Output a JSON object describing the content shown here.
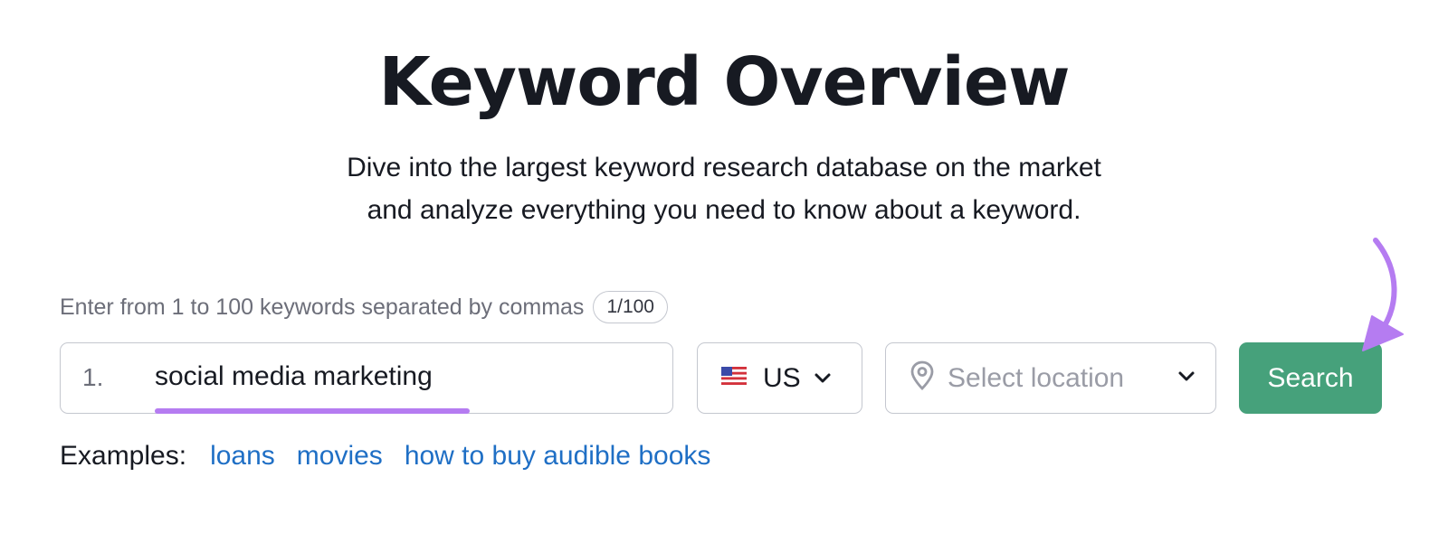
{
  "header": {
    "title": "Keyword Overview",
    "subtitle_line1": "Dive into the largest keyword research database on the market",
    "subtitle_line2": "and analyze everything you need to know about a keyword."
  },
  "form": {
    "hint": "Enter from 1 to 100 keywords separated by commas",
    "counter": "1/100",
    "keyword_number": "1.",
    "keyword_value": "social media marketing",
    "database": "US",
    "location_placeholder": "Select location",
    "search_label": "Search"
  },
  "examples": {
    "label": "Examples:",
    "links": [
      "loans",
      "movies",
      "how to buy audible books"
    ]
  },
  "colors": {
    "search_button": "#46a17b",
    "link": "#1f6fc5",
    "highlight": "#b57cf1"
  },
  "icons": {
    "flag": "us-flag-icon",
    "location": "location-pin-icon",
    "chevron": "chevron-down-icon",
    "annotation": "curved-arrow-icon"
  }
}
